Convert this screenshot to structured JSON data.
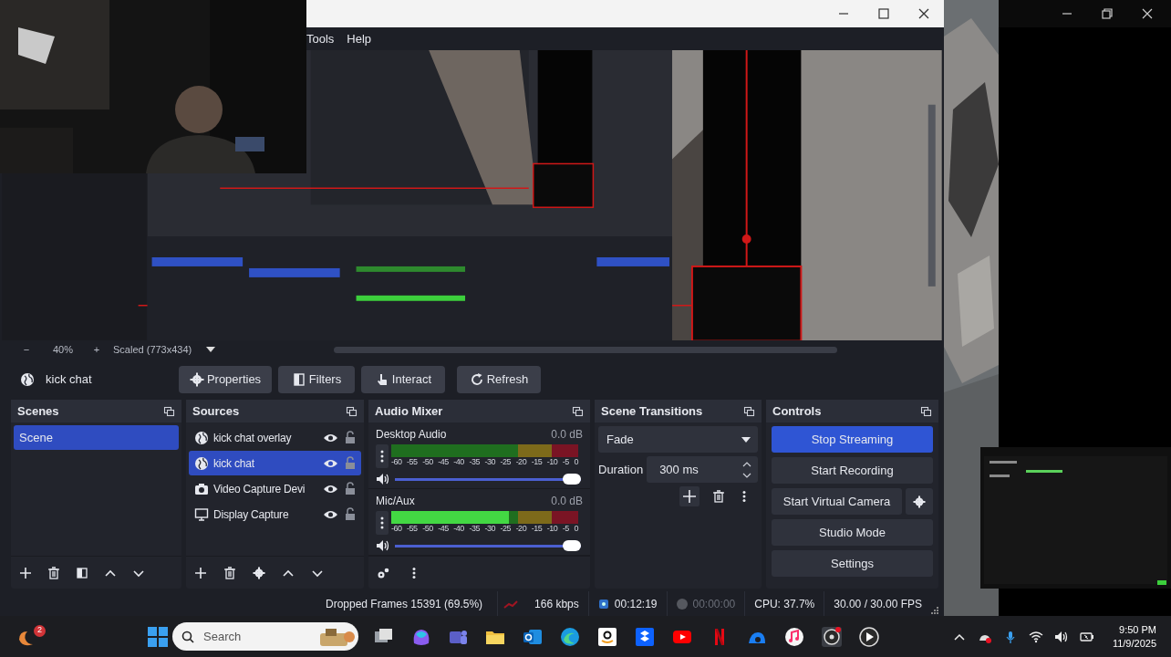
{
  "window": {
    "menu": [
      "Tools",
      "Help"
    ]
  },
  "preview_bar": {
    "minus": "−",
    "zoom": "40%",
    "plus": "+",
    "scale": "Scaled (773x434)"
  },
  "source_toolbar": {
    "source": "kick chat",
    "buttons": [
      {
        "label": "Properties",
        "kind": "gear"
      },
      {
        "label": "Filters",
        "kind": "filter"
      },
      {
        "label": "Interact",
        "kind": "hand"
      },
      {
        "label": "Refresh",
        "kind": "refresh"
      }
    ]
  },
  "scenes": {
    "title": "Scenes",
    "items": [
      {
        "label": "Scene",
        "selected": true
      }
    ]
  },
  "sources": {
    "title": "Sources",
    "items": [
      {
        "label": "kick chat overlay",
        "kind": "browser",
        "selected": false
      },
      {
        "label": "kick chat",
        "kind": "browser",
        "selected": true
      },
      {
        "label": "Video Capture Devi",
        "kind": "camera",
        "selected": false
      },
      {
        "label": "Display Capture",
        "kind": "display",
        "selected": false
      }
    ]
  },
  "audio_mixer": {
    "title": "Audio Mixer",
    "channels": [
      {
        "name": "Desktop Audio",
        "reading": "0.0 dB",
        "volume": {
          "level": 1
        },
        "scale": [
          "-60",
          "-55",
          "-50",
          "-45",
          "-40",
          "-35",
          "-30",
          "-25",
          "-20",
          "-15",
          "-10",
          "-5",
          "0"
        ]
      },
      {
        "name": "Mic/Aux",
        "reading": "0.0 dB",
        "meter": {
          "level": 0.63
        },
        "volume": {
          "level": 1
        },
        "scale": [
          "-60",
          "-55",
          "-50",
          "-45",
          "-40",
          "-35",
          "-30",
          "-25",
          "-20",
          "-15",
          "-10",
          "-5",
          "0"
        ]
      }
    ]
  },
  "scene_transitions": {
    "title": "Scene Transitions",
    "transition": "Fade",
    "duration_label": "Duration",
    "duration": "300 ms"
  },
  "controls": {
    "title": "Controls",
    "buttons": [
      {
        "label": "Stop Streaming",
        "active": true
      },
      {
        "label": "Start Recording",
        "active": false
      },
      {
        "label": "Start Virtual Camera",
        "active": false
      },
      {
        "label": "Studio Mode",
        "active": false
      },
      {
        "label": "Settings",
        "active": false
      }
    ]
  },
  "status_bar": {
    "dropped_frames": "Dropped Frames 15391 (69.5%)",
    "bitrate": "166 kbps",
    "stream_time": "00:12:19",
    "record_time": "00:00:00",
    "cpu": "CPU: 37.7%",
    "fps": "30.00 / 30.00 FPS"
  },
  "taskbar": {
    "badge": "2",
    "search_placeholder": "Search",
    "time": "9:50 PM",
    "date": "11/9/2025"
  }
}
